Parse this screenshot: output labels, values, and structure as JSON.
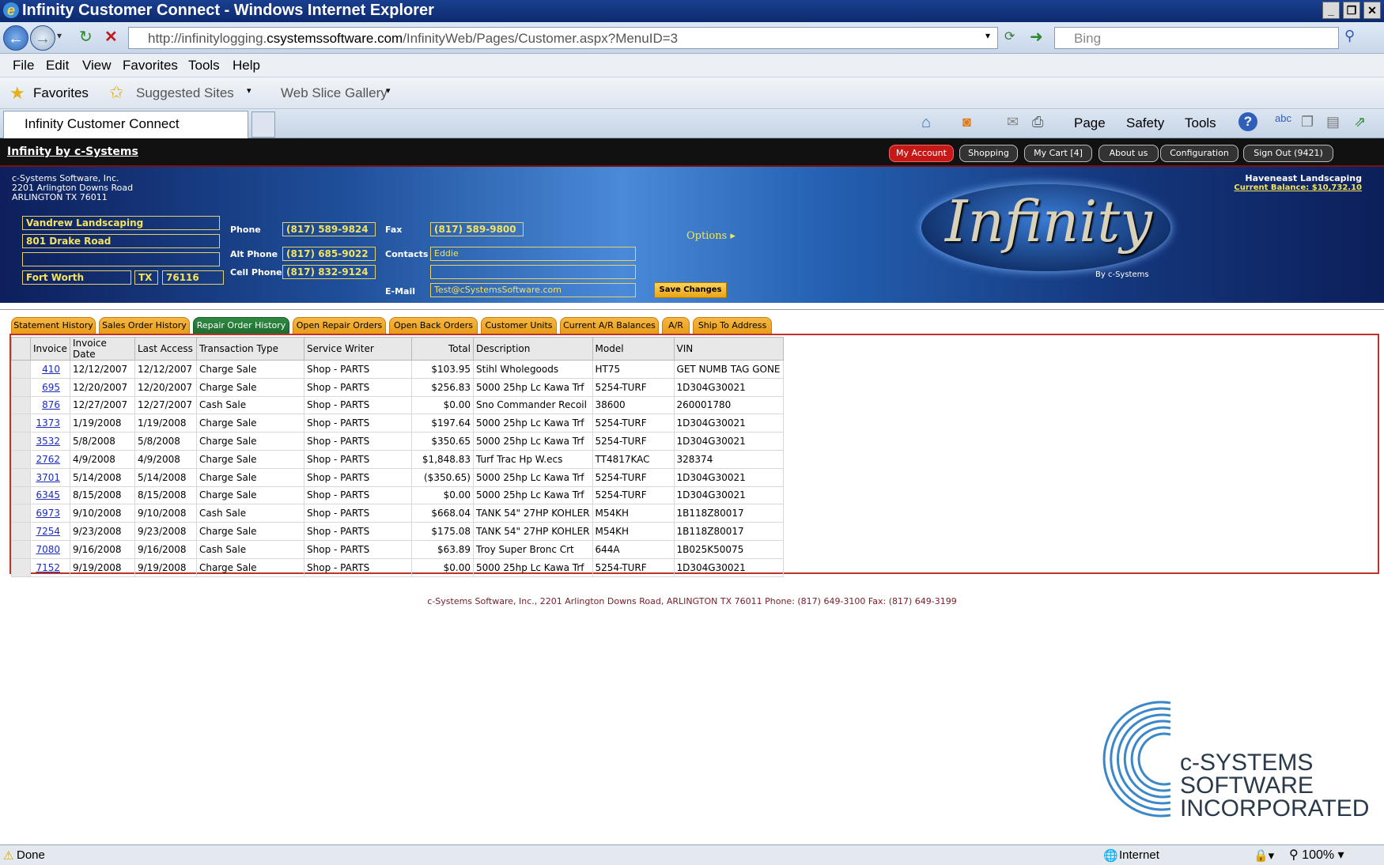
{
  "window": {
    "title": "Infinity Customer Connect - Windows Internet Explorer"
  },
  "browser": {
    "url_prefix": "http://infinitylogging.",
    "url_domain": "csystemssoftware.com",
    "url_path": "/InfinityWeb/Pages/Customer.aspx?MenuID=3",
    "search_placeholder": "Bing",
    "menu": [
      "File",
      "Edit",
      "View",
      "Favorites",
      "Tools",
      "Help"
    ],
    "favorites_label": "Favorites",
    "suggested_sites": "Suggested Sites",
    "web_slice": "Web Slice Gallery",
    "tab_title": "Infinity Customer Connect",
    "cmd_page": "Page",
    "cmd_safety": "Safety",
    "cmd_tools": "Tools",
    "status_done": "Done",
    "status_zone": "Internet",
    "zoom": "100%"
  },
  "header": {
    "brand": "Infinity by c-Systems",
    "buttons": [
      "My Account",
      "Shopping",
      "My Cart [4]",
      "About us",
      "Configuration",
      "Sign Out (9421)"
    ]
  },
  "company": {
    "name": "c-Systems Software, Inc.",
    "address1": "2201 Arlington Downs Road",
    "address2": "ARLINGTON TX 76011"
  },
  "account": {
    "customer": "Haveneast Landscaping",
    "balance": "Current Balance: $10,732.10"
  },
  "customer": {
    "name": "Vandrew Landscaping",
    "street": "801 Drake Road",
    "street2": "",
    "city": "Fort Worth",
    "state": "TX",
    "zip": "76116",
    "phone_label": "Phone",
    "phone": "(817) 589-9824",
    "alt_phone_label": "Alt Phone",
    "alt_phone": "(817) 685-9022",
    "cell_phone_label": "Cell Phone",
    "cell_phone": "(817) 832-9124",
    "fax_label": "Fax",
    "fax": "(817) 589-9800",
    "contacts_label": "Contacts",
    "contacts": "Eddie",
    "contacts2": "",
    "email_label": "E-Mail",
    "email": "Test@cSystemsSoftware.com",
    "options": "Options",
    "save": "Save Changes"
  },
  "logo": {
    "word": "Infinity",
    "by": "By c-Systems"
  },
  "tabs": [
    "Statement History",
    "Sales Order History",
    "Repair Order History",
    "Open Repair Orders",
    "Open Back Orders",
    "Customer Units",
    "Current A/R Balances",
    "A/R",
    "Ship To Address"
  ],
  "active_tab": "Repair Order History",
  "table": {
    "columns": [
      "Invoice",
      "Invoice Date",
      "Last Access",
      "Transaction Type",
      "Service Writer",
      "Total",
      "Description",
      "Model",
      "VIN"
    ],
    "rows": [
      [
        "410",
        "12/12/2007",
        "12/12/2007",
        "Charge Sale",
        "Shop - PARTS",
        "$103.95",
        "Stihl Wholegoods",
        "HT75",
        "GET NUMB TAG GONE"
      ],
      [
        "695",
        "12/20/2007",
        "12/20/2007",
        "Charge Sale",
        "Shop - PARTS",
        "$256.83",
        "5000 25hp Lc Kawa Trf",
        "5254-TURF",
        "1D304G30021"
      ],
      [
        "876",
        "12/27/2007",
        "12/27/2007",
        "Cash Sale",
        "Shop - PARTS",
        "$0.00",
        "Sno Commander Recoil",
        "38600",
        "260001780"
      ],
      [
        "1373",
        "1/19/2008",
        "1/19/2008",
        "Charge Sale",
        "Shop - PARTS",
        "$197.64",
        "5000 25hp Lc Kawa Trf",
        "5254-TURF",
        "1D304G30021"
      ],
      [
        "3532",
        "5/8/2008",
        "5/8/2008",
        "Charge Sale",
        "Shop - PARTS",
        "$350.65",
        "5000 25hp Lc Kawa Trf",
        "5254-TURF",
        "1D304G30021"
      ],
      [
        "2762",
        "4/9/2008",
        "4/9/2008",
        "Charge Sale",
        "Shop - PARTS",
        "$1,848.83",
        "Turf Trac Hp W.ecs",
        "TT4817KAC",
        "328374"
      ],
      [
        "3701",
        "5/14/2008",
        "5/14/2008",
        "Charge Sale",
        "Shop - PARTS",
        "($350.65)",
        "5000 25hp Lc Kawa Trf",
        "5254-TURF",
        "1D304G30021"
      ],
      [
        "6345",
        "8/15/2008",
        "8/15/2008",
        "Charge Sale",
        "Shop - PARTS",
        "$0.00",
        "5000 25hp Lc Kawa Trf",
        "5254-TURF",
        "1D304G30021"
      ],
      [
        "6973",
        "9/10/2008",
        "9/10/2008",
        "Cash Sale",
        "Shop - PARTS",
        "$668.04",
        "TANK 54\" 27HP KOHLER",
        "M54KH",
        "1B118Z80017"
      ],
      [
        "7254",
        "9/23/2008",
        "9/23/2008",
        "Charge Sale",
        "Shop - PARTS",
        "$175.08",
        "TANK 54\" 27HP KOHLER",
        "M54KH",
        "1B118Z80017"
      ],
      [
        "7080",
        "9/16/2008",
        "9/16/2008",
        "Cash Sale",
        "Shop - PARTS",
        "$63.89",
        "Troy Super Bronc Crt",
        "644A",
        "1B025K50075"
      ],
      [
        "7152",
        "9/19/2008",
        "9/19/2008",
        "Charge Sale",
        "Shop - PARTS",
        "$0.00",
        "5000 25hp Lc Kawa Trf",
        "5254-TURF",
        "1D304G30021"
      ]
    ]
  },
  "footer": "c-Systems Software, Inc., 2201 Arlington Downs Road, ARLINGTON TX 76011 Phone: (817) 649-3100 Fax: (817) 649-3199",
  "bottom_logo": {
    "line1": "c-SYSTEMS",
    "line2": "SOFTWARE",
    "line3": "INCORPORATED"
  },
  "colors": {
    "title_bar": "#0c2a6e",
    "tab_orange": "#e89b15",
    "tab_active_green": "#1c6a2e",
    "field_text": "#f4e35c",
    "link_blue": "#1a2bbd",
    "panel_border": "#c0332b"
  },
  "icons": [
    "ie-icon",
    "back-icon",
    "forward-icon",
    "refresh-icon",
    "stop-icon",
    "home-icon",
    "rss-icon",
    "mail-icon",
    "print-icon",
    "help-icon",
    "star-icon"
  ]
}
